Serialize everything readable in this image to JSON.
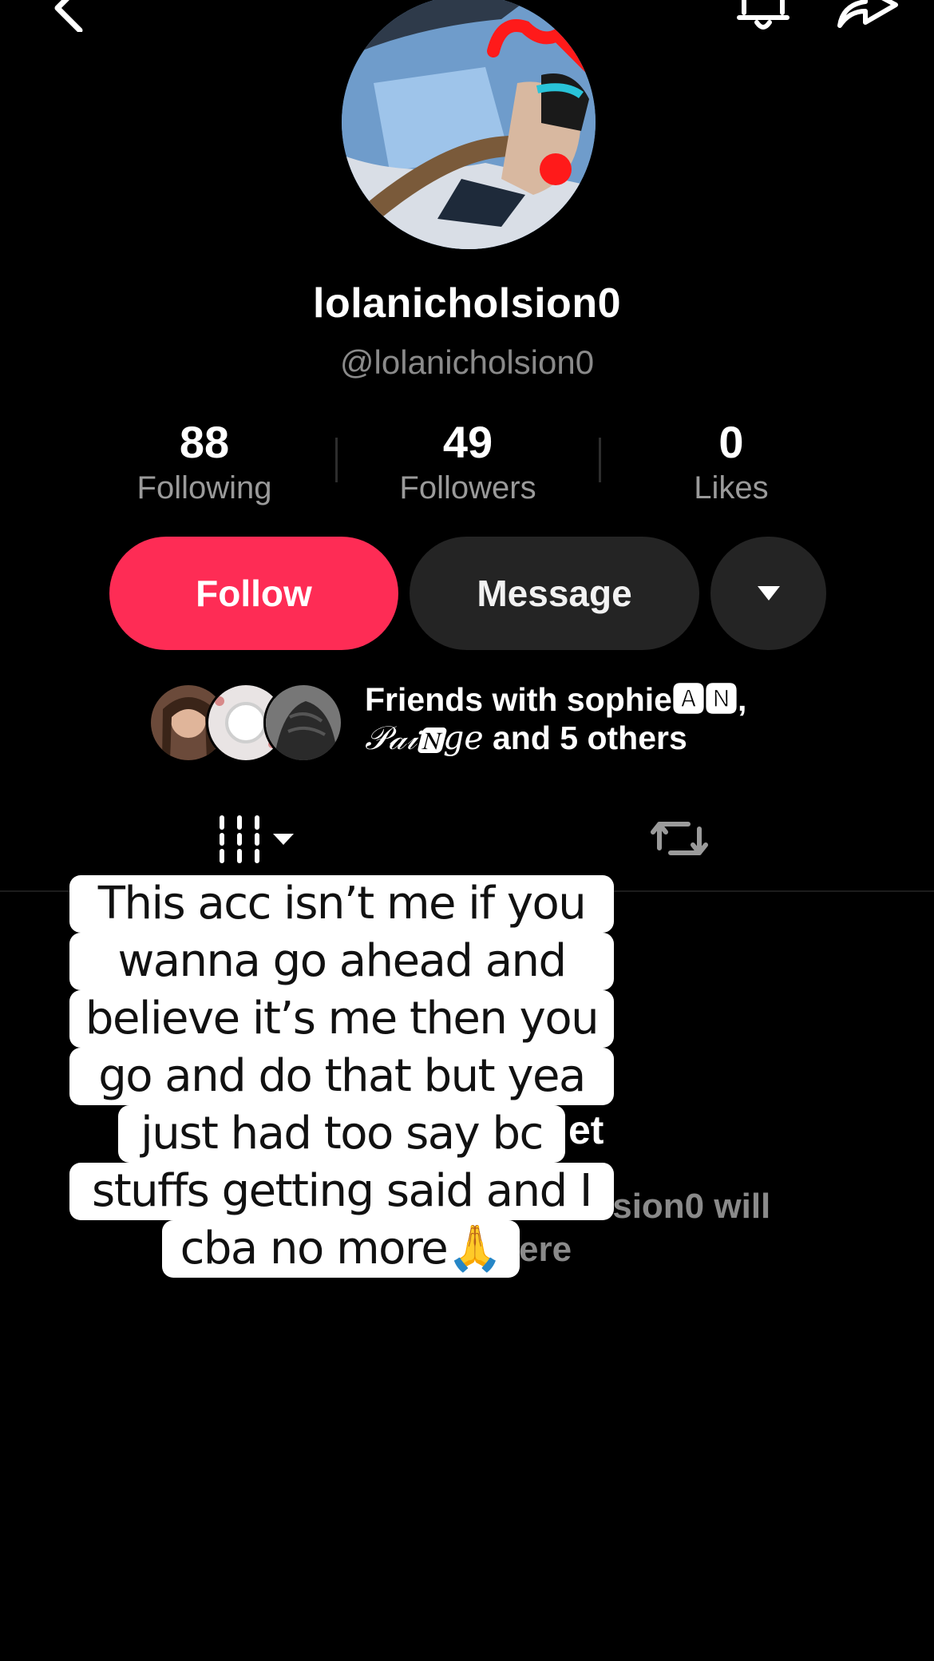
{
  "profile": {
    "display_name": "lolanicholsion0",
    "handle": "@lolanicholsion0"
  },
  "stats": [
    {
      "value": "88",
      "label": "Following"
    },
    {
      "value": "49",
      "label": "Followers"
    },
    {
      "value": "0",
      "label": "Likes"
    }
  ],
  "actions": {
    "follow_label": "Follow",
    "message_label": "Message"
  },
  "friends": {
    "line1": "Friends with sophie🅰🅽,",
    "line2_name": "𝒫𝒶𝒾🅽𝑔𝑒",
    "line2_rest": " and 5 others"
  },
  "empty_state": {
    "title_fragment": "et",
    "body_fragment_1": "lsion0 will",
    "body_fragment_2": "ere"
  },
  "caption": {
    "lines": [
      "This acc isn’t me if you",
      "wanna go ahead and",
      "believe it’s me then you",
      "go and do that but yea",
      "just had too say bc",
      "stuffs getting said and I",
      "cba no more🙏"
    ]
  },
  "colors": {
    "accent": "#fe2c55",
    "background": "#000000",
    "button_dark": "#242424",
    "muted_text": "#8a8a8a"
  },
  "icons": [
    "back-icon",
    "bell-icon",
    "share-icon",
    "chevron-down-icon",
    "grid-icon",
    "repost-icon"
  ]
}
